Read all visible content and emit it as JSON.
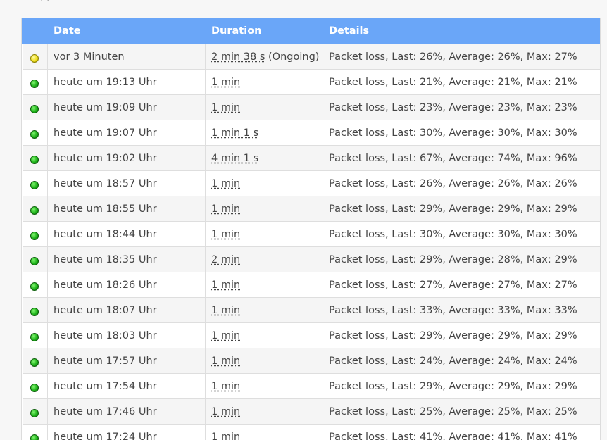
{
  "top_fragment": "(        )",
  "table": {
    "headers": {
      "status": "",
      "date": "Date",
      "duration": "Duration",
      "details": "Details"
    },
    "rows": [
      {
        "status": "yellow",
        "date": "vor 3 Minuten",
        "duration": "2 min 38 s",
        "duration_suffix": " (Ongoing)",
        "details": "Packet loss, Last: 26%, Average: 26%, Max: 27%"
      },
      {
        "status": "green",
        "date": "heute um 19:13 Uhr",
        "duration": "1 min",
        "duration_suffix": "",
        "details": "Packet loss, Last: 21%, Average: 21%, Max: 21%"
      },
      {
        "status": "green",
        "date": "heute um 19:09 Uhr",
        "duration": "1 min",
        "duration_suffix": "",
        "details": "Packet loss, Last: 23%, Average: 23%, Max: 23%"
      },
      {
        "status": "green",
        "date": "heute um 19:07 Uhr",
        "duration": "1 min 1 s",
        "duration_suffix": "",
        "details": "Packet loss, Last: 30%, Average: 30%, Max: 30%"
      },
      {
        "status": "green",
        "date": "heute um 19:02 Uhr",
        "duration": "4 min 1 s",
        "duration_suffix": "",
        "details": "Packet loss, Last: 67%, Average: 74%, Max: 96%"
      },
      {
        "status": "green",
        "date": "heute um 18:57 Uhr",
        "duration": "1 min",
        "duration_suffix": "",
        "details": "Packet loss, Last: 26%, Average: 26%, Max: 26%"
      },
      {
        "status": "green",
        "date": "heute um 18:55 Uhr",
        "duration": "1 min",
        "duration_suffix": "",
        "details": "Packet loss, Last: 29%, Average: 29%, Max: 29%"
      },
      {
        "status": "green",
        "date": "heute um 18:44 Uhr",
        "duration": "1 min",
        "duration_suffix": "",
        "details": "Packet loss, Last: 30%, Average: 30%, Max: 30%"
      },
      {
        "status": "green",
        "date": "heute um 18:35 Uhr",
        "duration": "2 min",
        "duration_suffix": "",
        "details": "Packet loss, Last: 29%, Average: 28%, Max: 29%"
      },
      {
        "status": "green",
        "date": "heute um 18:26 Uhr",
        "duration": "1 min",
        "duration_suffix": "",
        "details": "Packet loss, Last: 27%, Average: 27%, Max: 27%"
      },
      {
        "status": "green",
        "date": "heute um 18:07 Uhr",
        "duration": "1 min",
        "duration_suffix": "",
        "details": "Packet loss, Last: 33%, Average: 33%, Max: 33%"
      },
      {
        "status": "green",
        "date": "heute um 18:03 Uhr",
        "duration": "1 min",
        "duration_suffix": "",
        "details": "Packet loss, Last: 29%, Average: 29%, Max: 29%"
      },
      {
        "status": "green",
        "date": "heute um 17:57 Uhr",
        "duration": "1 min",
        "duration_suffix": "",
        "details": "Packet loss, Last: 24%, Average: 24%, Max: 24%"
      },
      {
        "status": "green",
        "date": "heute um 17:54 Uhr",
        "duration": "1 min",
        "duration_suffix": "",
        "details": "Packet loss, Last: 29%, Average: 29%, Max: 29%"
      },
      {
        "status": "green",
        "date": "heute um 17:46 Uhr",
        "duration": "1 min",
        "duration_suffix": "",
        "details": "Packet loss, Last: 25%, Average: 25%, Max: 25%"
      },
      {
        "status": "green",
        "date": "heute um 17:24 Uhr",
        "duration": "1 min",
        "duration_suffix": "",
        "details": "Packet loss, Last: 41%, Average: 41%, Max: 41%"
      }
    ]
  },
  "colors": {
    "header_bg": "#6aa6f8",
    "status_green": "#1eb31a",
    "status_yellow": "#f0e020"
  }
}
